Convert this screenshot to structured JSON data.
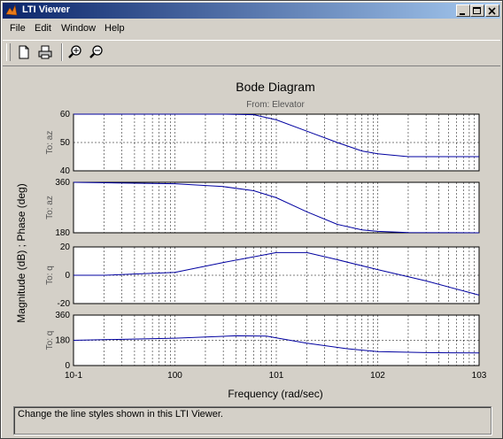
{
  "window": {
    "title": "LTI Viewer"
  },
  "menu": [
    "File",
    "Edit",
    "Window",
    "Help"
  ],
  "toolbar": {
    "tools": [
      "new-document-icon",
      "print-icon",
      "zoom-in-icon",
      "zoom-out-icon"
    ]
  },
  "status": {
    "text": "Change the line styles shown in this LTI Viewer."
  },
  "colors": {
    "accent": "#0a246a",
    "trace": "#0000a0",
    "plot_bg": "#ffffff"
  },
  "chart_data": {
    "type": "line",
    "title": "Bode Diagram",
    "subtitle": "From: Elevator",
    "xlabel": "Frequency  (rad/sec)",
    "ylabel": "Magnitude (dB) ; Phase (deg)",
    "xscale": "log",
    "xlim": [
      0.1,
      1000
    ],
    "xticks": [
      "10-1",
      "100",
      "101",
      "102",
      "103"
    ],
    "grid": true,
    "panels": [
      {
        "label": "To: az",
        "kind": "magnitude",
        "ylim": [
          40,
          60
        ],
        "yticks": [
          40,
          50,
          60
        ],
        "x": [
          0.1,
          1,
          3,
          6,
          10,
          20,
          40,
          70,
          100,
          200,
          1000
        ],
        "y": [
          60,
          60,
          60,
          59.8,
          58,
          54,
          50,
          47,
          46,
          45,
          45
        ]
      },
      {
        "label": "To: az",
        "kind": "phase",
        "ylim": [
          180,
          360
        ],
        "yticks": [
          180,
          360
        ],
        "x": [
          0.1,
          1,
          3,
          6,
          10,
          20,
          40,
          70,
          100,
          200,
          1000
        ],
        "y": [
          360,
          355,
          345,
          330,
          305,
          255,
          210,
          190,
          185,
          181,
          180
        ]
      },
      {
        "label": "To: q",
        "kind": "magnitude",
        "ylim": [
          -20,
          20
        ],
        "yticks": [
          -20,
          0,
          20
        ],
        "x": [
          0.1,
          0.2,
          1,
          3,
          10,
          20,
          40,
          100,
          300,
          1000
        ],
        "y": [
          0,
          0,
          2,
          9,
          16,
          16,
          11,
          4,
          -4,
          -14
        ]
      },
      {
        "label": "To: q",
        "kind": "phase",
        "ylim": [
          0,
          360
        ],
        "yticks": [
          0,
          180,
          360
        ],
        "x": [
          0.1,
          1,
          4,
          8,
          20,
          50,
          100,
          300,
          1000
        ],
        "y": [
          180,
          195,
          212,
          210,
          160,
          120,
          100,
          92,
          90
        ]
      }
    ]
  }
}
